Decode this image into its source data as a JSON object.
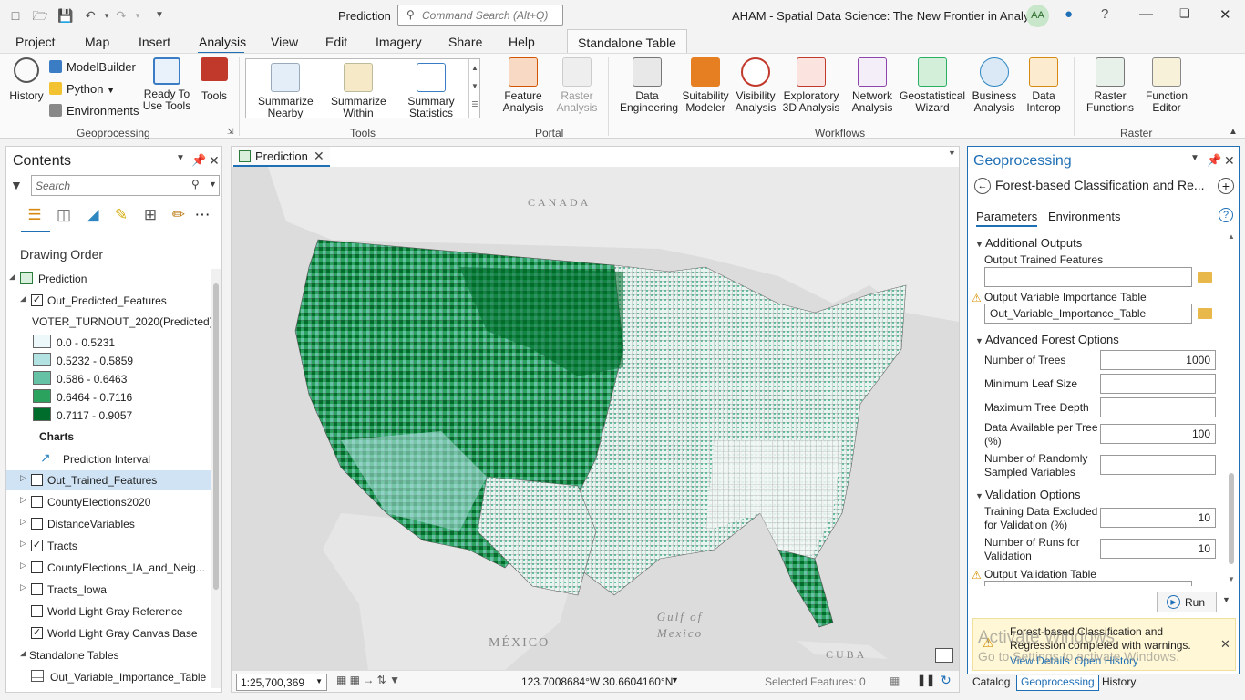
{
  "titlebar": {
    "app_title": "Prediction",
    "search_placeholder": "Command Search (Alt+Q)",
    "project_title": "AHAM - Spatial Data Science:  The New Frontier in Analytics",
    "user_initials": "AA",
    "help": "?"
  },
  "ribbon_tabs": [
    "Project",
    "Map",
    "Insert",
    "Analysis",
    "View",
    "Edit",
    "Imagery",
    "Share",
    "Help"
  ],
  "standalone_tab": "Standalone Table",
  "ribbon": {
    "geoprocessing": {
      "label": "Geoprocessing",
      "history": "History",
      "modelbuilder": "ModelBuilder",
      "python": "Python",
      "environments": "Environments",
      "ready_to_use": "Ready To Use Tools",
      "tools": "Tools"
    },
    "tools": {
      "label": "Tools",
      "summarize_nearby": "Summarize Nearby",
      "summarize_within": "Summarize Within",
      "summary_statistics": "Summary Statistics"
    },
    "portal": {
      "label": "Portal",
      "feature_analysis": "Feature Analysis",
      "raster_analysis": "Raster Analysis"
    },
    "workflows": {
      "label": "Workflows",
      "data_engineering": "Data Engineering",
      "suitability_modeler": "Suitability Modeler",
      "visibility_analysis": "Visibility Analysis",
      "exploratory_3d": "Exploratory 3D Analysis",
      "network_analysis": "Network Analysis",
      "geostatistical_wizard": "Geostatistical Wizard",
      "business_analysis": "Business Analysis",
      "data_interop": "Data Interop"
    },
    "raster": {
      "label": "Raster",
      "raster_functions": "Raster Functions",
      "function_editor": "Function Editor"
    }
  },
  "contents": {
    "title": "Contents",
    "search_placeholder": "Search",
    "drawing_order": "Drawing Order",
    "map_name": "Prediction",
    "layer_predicted": "Out_Predicted_Features",
    "field_name": "VOTER_TURNOUT_2020(Predicted)",
    "legend": [
      {
        "label": "0.0 - 0.5231",
        "color": "#edf8fb"
      },
      {
        "label": "0.5232 - 0.5859",
        "color": "#b2e2e2"
      },
      {
        "label": "0.586 - 0.6463",
        "color": "#66c2a4"
      },
      {
        "label": "0.6464 - 0.7116",
        "color": "#2ca25f"
      },
      {
        "label": "0.7117 - 0.9057",
        "color": "#006d2c"
      }
    ],
    "charts_heading": "Charts",
    "chart_item": "Prediction Interval",
    "layers": [
      {
        "label": "Out_Trained_Features",
        "checked": false
      },
      {
        "label": "CountyElections2020",
        "checked": false
      },
      {
        "label": "DistanceVariables",
        "checked": false
      },
      {
        "label": "Tracts",
        "checked": true
      },
      {
        "label": "CountyElections_IA_and_Neig...",
        "checked": false
      },
      {
        "label": "Tracts_Iowa",
        "checked": false
      },
      {
        "label": "World Light Gray Reference",
        "checked": false
      },
      {
        "label": "World Light Gray Canvas Base",
        "checked": true
      }
    ],
    "standalone_heading": "Standalone Tables",
    "standalone_item": "Out_Variable_Importance_Table"
  },
  "map": {
    "tab": "Prediction",
    "labels": {
      "canada": "CANADA",
      "mexico": "MÉXICO",
      "gulf": "Gulf of Mexico",
      "cuba": "CUBA"
    },
    "scale": "1:25,700,369",
    "coords": "123.7008684°W 30.6604160°N",
    "selected": "Selected Features: 0"
  },
  "geo": {
    "title": "Geoprocessing",
    "tool_name": "Forest-based Classification and Re...",
    "tab_parameters": "Parameters",
    "tab_environments": "Environments",
    "sec_additional": "Additional Outputs",
    "lbl_output_trained": "Output Trained Features",
    "val_output_trained": "",
    "lbl_var_importance": "Output Variable Importance Table",
    "val_var_importance": "Out_Variable_Importance_Table",
    "sec_advanced": "Advanced Forest Options",
    "lbl_num_trees": "Number of Trees",
    "val_num_trees": "1000",
    "lbl_min_leaf": "Minimum Leaf Size",
    "val_min_leaf": "",
    "lbl_max_depth": "Maximum Tree Depth",
    "val_max_depth": "",
    "lbl_data_per_tree_1": "Data Available per Tree",
    "lbl_data_per_tree_2": "(%)",
    "val_data_per_tree": "100",
    "lbl_random_vars_1": "Number of Randomly",
    "lbl_random_vars_2": "Sampled Variables",
    "val_random_vars": "",
    "sec_validation": "Validation Options",
    "lbl_excluded_1": "Training Data Excluded",
    "lbl_excluded_2": "for Validation (%)",
    "val_excluded": "10",
    "lbl_runs_1": "Number of Runs for",
    "lbl_runs_2": "Validation",
    "val_runs": "10",
    "lbl_output_validation": "Output  Validation Table",
    "run": "Run",
    "warning_1": "Forest-based Classification and",
    "warning_2": "Regression completed with warnings.",
    "view_details": "View Details",
    "open_history": "Open History"
  },
  "bottom_tabs": [
    "Catalog",
    "Geoprocessing",
    "History"
  ],
  "watermark": {
    "line1": "Activate Windows",
    "line2": "Go to Settings to activate Windows."
  }
}
